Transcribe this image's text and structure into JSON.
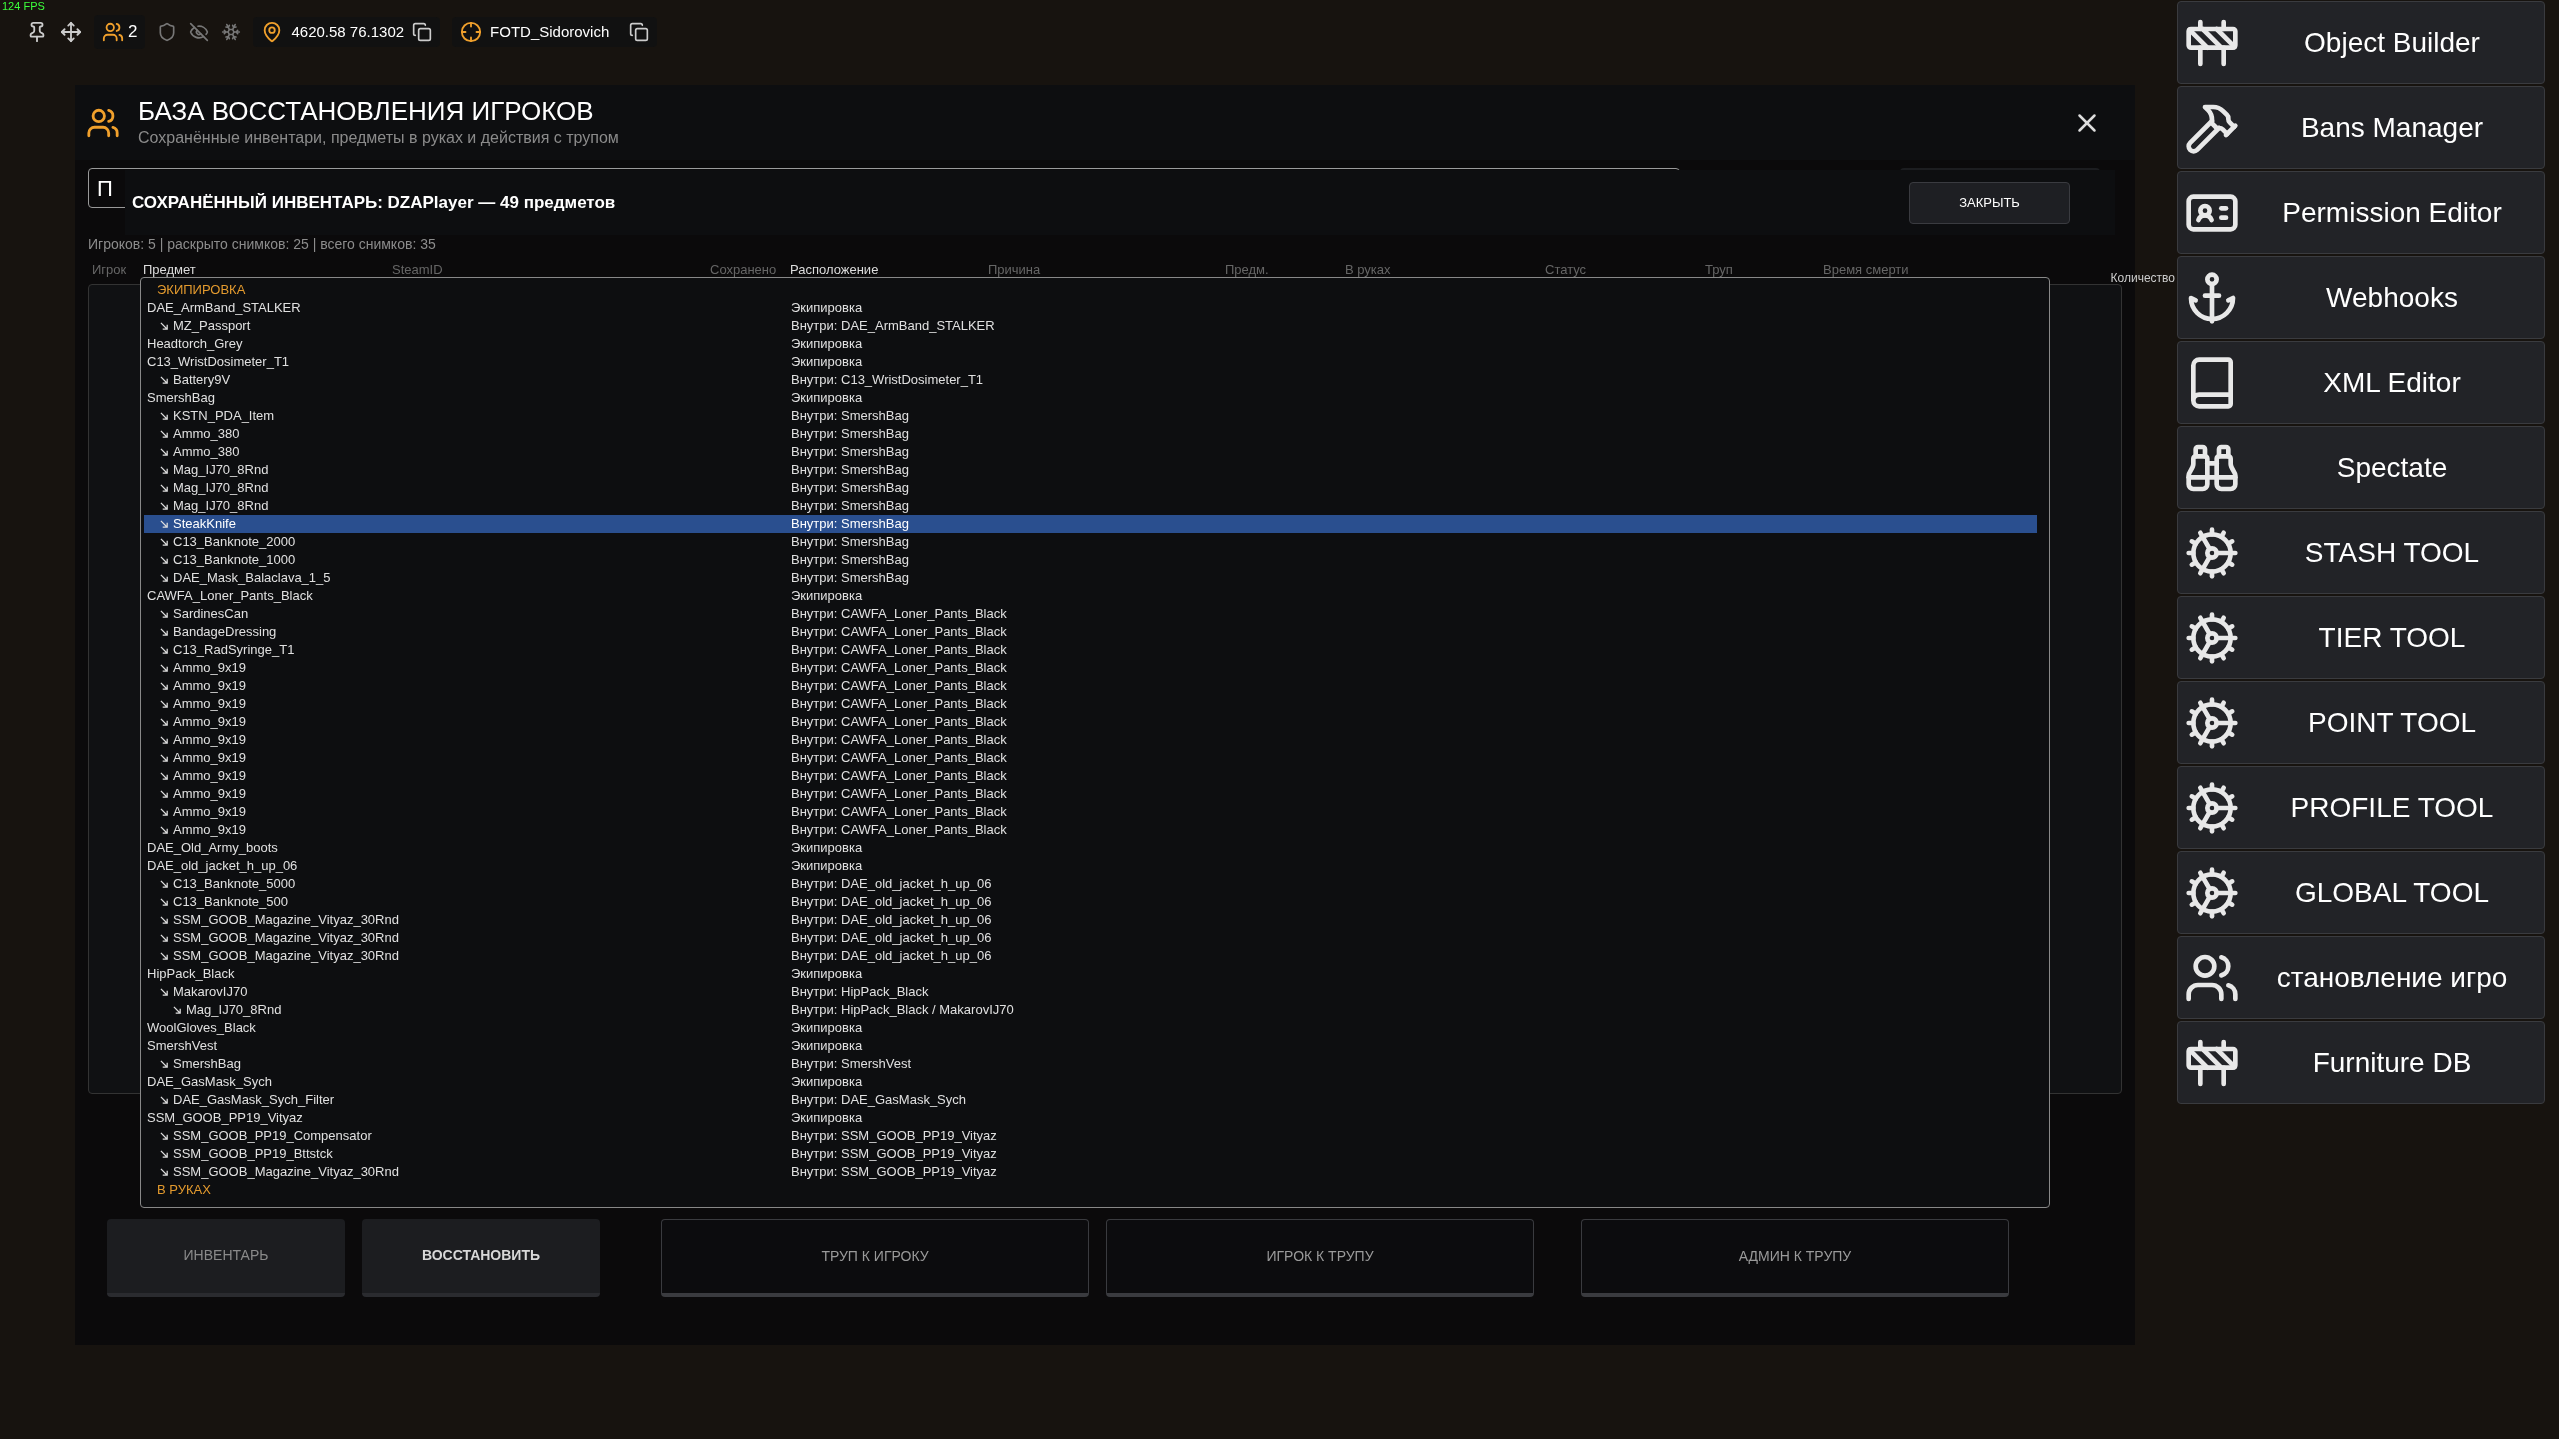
{
  "fps": "124 FPS",
  "toolbar": {
    "players_count": "2",
    "coordinates": "4620.58 76.1302",
    "target": "FOTD_Sidorovich"
  },
  "window": {
    "title": "БАЗА ВОССТАНОВЛЕНИЯ ИГРОКОВ",
    "subtitle": "Сохранённые инвентари, предметы в руках и действия с трупом"
  },
  "search": {
    "value": "П"
  },
  "stats": "Игроков: 5 | раскрыто снимков: 25 | всего снимков: 35",
  "table": {
    "columns": [
      {
        "label": "Игрок"
      },
      {
        "label": "SteamID"
      },
      {
        "label": "Сохранено"
      },
      {
        "label": "Причина"
      },
      {
        "label": "Предм."
      },
      {
        "label": "В руках"
      },
      {
        "label": "Статус"
      },
      {
        "label": "Труп"
      },
      {
        "label": "Время смерти"
      }
    ]
  },
  "quantity_label": "Количество",
  "popup": {
    "title": "СОХРАНЁННЫЙ ИНВЕНТАРЬ: DZAPlayer — 49 предметов",
    "close_button": "ЗАКРЫТЬ",
    "columns": [
      "Предмет",
      "Расположение"
    ],
    "sections": [
      {
        "title": "ЭКИПИРОВКА",
        "items": [
          {
            "name": "DAE_ArmBand_STALKER",
            "location": "Экипировка",
            "selected": false,
            "children": [
              {
                "name": "MZ_Passport",
                "location": "Внутри: DAE_ArmBand_STALKER",
                "selected": false
              }
            ]
          },
          {
            "name": "Headtorch_Grey",
            "location": "Экипировка",
            "selected": false
          },
          {
            "name": "C13_WristDosimeter_T1",
            "location": "Экипировка",
            "selected": false,
            "children": [
              {
                "name": "Battery9V",
                "location": "Внутри: C13_WristDosimeter_T1",
                "selected": false
              }
            ]
          },
          {
            "name": "SmershBag",
            "location": "Экипировка",
            "selected": false,
            "children": [
              {
                "name": "KSTN_PDA_Item",
                "location": "Внутри: SmershBag",
                "selected": false
              },
              {
                "name": "Ammo_380",
                "location": "Внутри: SmershBag",
                "selected": false
              },
              {
                "name": "Ammo_380",
                "location": "Внутри: SmershBag",
                "selected": false
              },
              {
                "name": "Mag_IJ70_8Rnd",
                "location": "Внутри: SmershBag",
                "selected": false
              },
              {
                "name": "Mag_IJ70_8Rnd",
                "location": "Внутри: SmershBag",
                "selected": false
              },
              {
                "name": "Mag_IJ70_8Rnd",
                "location": "Внутри: SmershBag",
                "selected": false
              },
              {
                "name": "SteakKnife",
                "location": "Внутри: SmershBag",
                "selected": true
              },
              {
                "name": "C13_Banknote_2000",
                "location": "Внутри: SmershBag",
                "selected": false
              },
              {
                "name": "C13_Banknote_1000",
                "location": "Внутри: SmershBag",
                "selected": false
              },
              {
                "name": "DAE_Mask_Balaclava_1_5",
                "location": "Внутри: SmershBag",
                "selected": false
              }
            ]
          },
          {
            "name": "CAWFA_Loner_Pants_Black",
            "location": "Экипировка",
            "selected": false,
            "children": [
              {
                "name": "SardinesCan",
                "location": "Внутри: CAWFA_Loner_Pants_Black",
                "selected": false
              },
              {
                "name": "BandageDressing",
                "location": "Внутри: CAWFA_Loner_Pants_Black",
                "selected": false
              },
              {
                "name": "C13_RadSyringe_T1",
                "location": "Внутри: CAWFA_Loner_Pants_Black",
                "selected": false
              },
              {
                "name": "Ammo_9x19",
                "location": "Внутри: CAWFA_Loner_Pants_Black",
                "selected": false
              },
              {
                "name": "Ammo_9x19",
                "location": "Внутри: CAWFA_Loner_Pants_Black",
                "selected": false
              },
              {
                "name": "Ammo_9x19",
                "location": "Внутри: CAWFA_Loner_Pants_Black",
                "selected": false
              },
              {
                "name": "Ammo_9x19",
                "location": "Внутри: CAWFA_Loner_Pants_Black",
                "selected": false
              },
              {
                "name": "Ammo_9x19",
                "location": "Внутри: CAWFA_Loner_Pants_Black",
                "selected": false
              },
              {
                "name": "Ammo_9x19",
                "location": "Внутри: CAWFA_Loner_Pants_Black",
                "selected": false
              },
              {
                "name": "Ammo_9x19",
                "location": "Внутри: CAWFA_Loner_Pants_Black",
                "selected": false
              },
              {
                "name": "Ammo_9x19",
                "location": "Внутри: CAWFA_Loner_Pants_Black",
                "selected": false
              },
              {
                "name": "Ammo_9x19",
                "location": "Внутри: CAWFA_Loner_Pants_Black",
                "selected": false
              },
              {
                "name": "Ammo_9x19",
                "location": "Внутри: CAWFA_Loner_Pants_Black",
                "selected": false
              }
            ]
          },
          {
            "name": "DAE_Old_Army_boots",
            "location": "Экипировка",
            "selected": false
          },
          {
            "name": "DAE_old_jacket_h_up_06",
            "location": "Экипировка",
            "selected": false,
            "children": [
              {
                "name": "C13_Banknote_5000",
                "location": "Внутри: DAE_old_jacket_h_up_06",
                "selected": false
              },
              {
                "name": "C13_Banknote_500",
                "location": "Внутри: DAE_old_jacket_h_up_06",
                "selected": false
              },
              {
                "name": "SSM_GOOB_Magazine_Vityaz_30Rnd",
                "location": "Внутри: DAE_old_jacket_h_up_06",
                "selected": false
              },
              {
                "name": "SSM_GOOB_Magazine_Vityaz_30Rnd",
                "location": "Внутри: DAE_old_jacket_h_up_06",
                "selected": false
              },
              {
                "name": "SSM_GOOB_Magazine_Vityaz_30Rnd",
                "location": "Внутри: DAE_old_jacket_h_up_06",
                "selected": false
              }
            ]
          },
          {
            "name": "HipPack_Black",
            "location": "Экипировка",
            "selected": false,
            "children": [
              {
                "name": "MakarovIJ70",
                "location": "Внутри: HipPack_Black",
                "selected": false,
                "children": [
                  {
                    "name": "Mag_IJ70_8Rnd",
                    "location": "Внутри: HipPack_Black / MakarovIJ70",
                    "selected": false
                  }
                ]
              }
            ]
          },
          {
            "name": "WoolGloves_Black",
            "location": "Экипировка",
            "selected": false
          },
          {
            "name": "SmershVest",
            "location": "Экипировка",
            "selected": false,
            "children": [
              {
                "name": "SmershBag",
                "location": "Внутри: SmershVest",
                "selected": false
              }
            ]
          },
          {
            "name": "DAE_GasMask_Sych",
            "location": "Экипировка",
            "selected": false,
            "children": [
              {
                "name": "DAE_GasMask_Sych_Filter",
                "location": "Внутри: DAE_GasMask_Sych",
                "selected": false
              }
            ]
          },
          {
            "name": "SSM_GOOB_PP19_Vityaz",
            "location": "Экипировка",
            "selected": false,
            "children": [
              {
                "name": "SSM_GOOB_PP19_Compensator",
                "location": "Внутри: SSM_GOOB_PP19_Vityaz",
                "selected": false
              },
              {
                "name": "SSM_GOOB_PP19_Bttstck",
                "location": "Внутри: SSM_GOOB_PP19_Vityaz",
                "selected": false
              },
              {
                "name": "SSM_GOOB_Magazine_Vityaz_30Rnd",
                "location": "Внутри: SSM_GOOB_PP19_Vityaz",
                "selected": false
              }
            ]
          }
        ]
      },
      {
        "title": "В РУКАХ"
      }
    ]
  },
  "actions": [
    {
      "label": "ИНВЕНТАРЬ",
      "kind": "dim"
    },
    {
      "label": "ВОССТАНОВИТЬ",
      "kind": "strong"
    },
    {
      "label": "ТРУП К ИГРОКУ",
      "kind": "outline"
    },
    {
      "label": "ИГРОК К ТРУПУ",
      "kind": "outline"
    },
    {
      "label": "АДМИН К ТРУПУ",
      "kind": "outline"
    }
  ],
  "sidebar": {
    "items": [
      {
        "label": "Object Builder"
      },
      {
        "label": "Bans Manager"
      },
      {
        "label": "Permission Editor"
      },
      {
        "label": "Webhooks"
      },
      {
        "label": "XML Editor"
      },
      {
        "label": "Spectate"
      },
      {
        "label": "STASH TOOL"
      },
      {
        "label": "TIER TOOL"
      },
      {
        "label": "POINT TOOL"
      },
      {
        "label": "PROFILE TOOL"
      },
      {
        "label": "GLOBAL TOOL"
      },
      {
        "label": "становление игро"
      },
      {
        "label": "Furniture DB"
      }
    ]
  }
}
